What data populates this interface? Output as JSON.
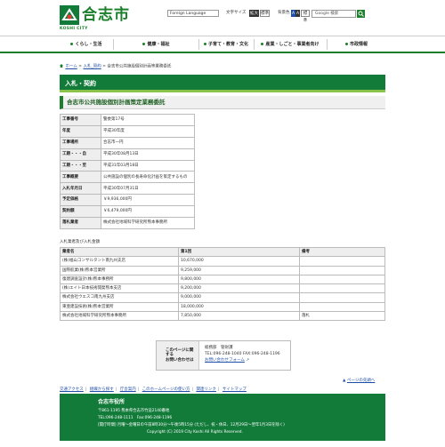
{
  "header": {
    "city_name": "合志市",
    "city_name_en": "KOSHI CITY",
    "lang_button": "Foreign Language",
    "font_size_label": "文字サイズ",
    "font_size_large": "拡大",
    "font_size_standard": "標準",
    "bg_color_label": "背景色",
    "bg_a1": "A",
    "bg_a2": "A",
    "bg_standard": "標準",
    "search_placeholder": "Google 検索"
  },
  "nav": {
    "items": [
      {
        "label": "くらし・生活"
      },
      {
        "label": "健康・福祉"
      },
      {
        "label": "子育て・教育・文化"
      },
      {
        "label": "産業・しごと・事業者向け"
      },
      {
        "label": "市政情報"
      }
    ]
  },
  "breadcrumb": {
    "home": "ホーム",
    "sep1": ">",
    "level1": "入札_契約",
    "sep2": ">",
    "current": "合志市公共施設個別計画等業務委託"
  },
  "section": {
    "title": "入札・契約"
  },
  "page": {
    "title": "合志市公共施設個別計画策定業務委託"
  },
  "info": {
    "rows": [
      {
        "label": "工事番号",
        "value": "警委第17号"
      },
      {
        "label": "年度",
        "value": "平成30年度"
      },
      {
        "label": "工事場所",
        "value": "合志市一円"
      },
      {
        "label": "工期・・・自",
        "value": "平成30年08月13日"
      },
      {
        "label": "工期・・・至",
        "value": "平成31年03月18日"
      },
      {
        "label": "工事概要",
        "value": "公共施設の個別の長寿命化計画を策定するもの"
      },
      {
        "label": "入札年月日",
        "value": "平成30年07月31日"
      },
      {
        "label": "予定価格",
        "value": "￥9,936,000円"
      },
      {
        "label": "契約額",
        "value": "￥6,479,000円"
      },
      {
        "label": "落札業者",
        "value": "株式会社地域科学研究所熊本事務所"
      }
    ]
  },
  "bids": {
    "caption": "入札業者及び入札金額",
    "headers": [
      "業者名",
      "第1回",
      "備考"
    ],
    "rows": [
      {
        "name": "(株)福山コンサルタント南九州支店",
        "amount": "10,670,000",
        "note": ""
      },
      {
        "name": "国際航業(株)熊本営業所",
        "amount": "9,259,000",
        "note": ""
      },
      {
        "name": "復建調査設計(株)熊本事務所",
        "amount": "9,800,000",
        "note": ""
      },
      {
        "name": "(株)エイト日本技術開発熊本支店",
        "amount": "9,200,000",
        "note": ""
      },
      {
        "name": "株式会社ウエスコ南九州支店",
        "amount": "9,000,000",
        "note": ""
      },
      {
        "name": "東亜建設技術(株)熊本営業所",
        "amount": "18,000,000",
        "note": ""
      },
      {
        "name": "株式会社地域科学研究所熊本事務所",
        "amount": "7,850,000",
        "note": "落札"
      }
    ]
  },
  "contact": {
    "heading_line1": "このページに関する",
    "heading_line2": "お問い合わせは",
    "dept": "総務部　管財課",
    "tel": "TEL:096-248-1040 FAX:096-248-1196",
    "mail": "お問い合わせフォーム"
  },
  "pagetop": "ページの先頭へ",
  "footer_links": [
    "交通アクセス",
    "組織から探す",
    "庁舎案内",
    "このホームページの使い方",
    "関連リンク",
    "サイトマップ"
  ],
  "footer": {
    "name": "合志市役所",
    "address": "〒861-1195 熊本県合志市竹迫2140番地",
    "phone": "TEL:096-248-1111　Fax:096-248-1196",
    "hours": "[開庁時間] 月曜～金曜日の午前8時30分～午後5時15分 (ただし、祝・休日、12月29日～翌年1月3日を除く)",
    "copyright": "Copyright (C) 2019 City Koshi All Rights Reserved."
  },
  "colors": {
    "brand_green": "#127b3a",
    "accent_lime": "#8bc34a",
    "link_blue": "#1e4fa8"
  }
}
